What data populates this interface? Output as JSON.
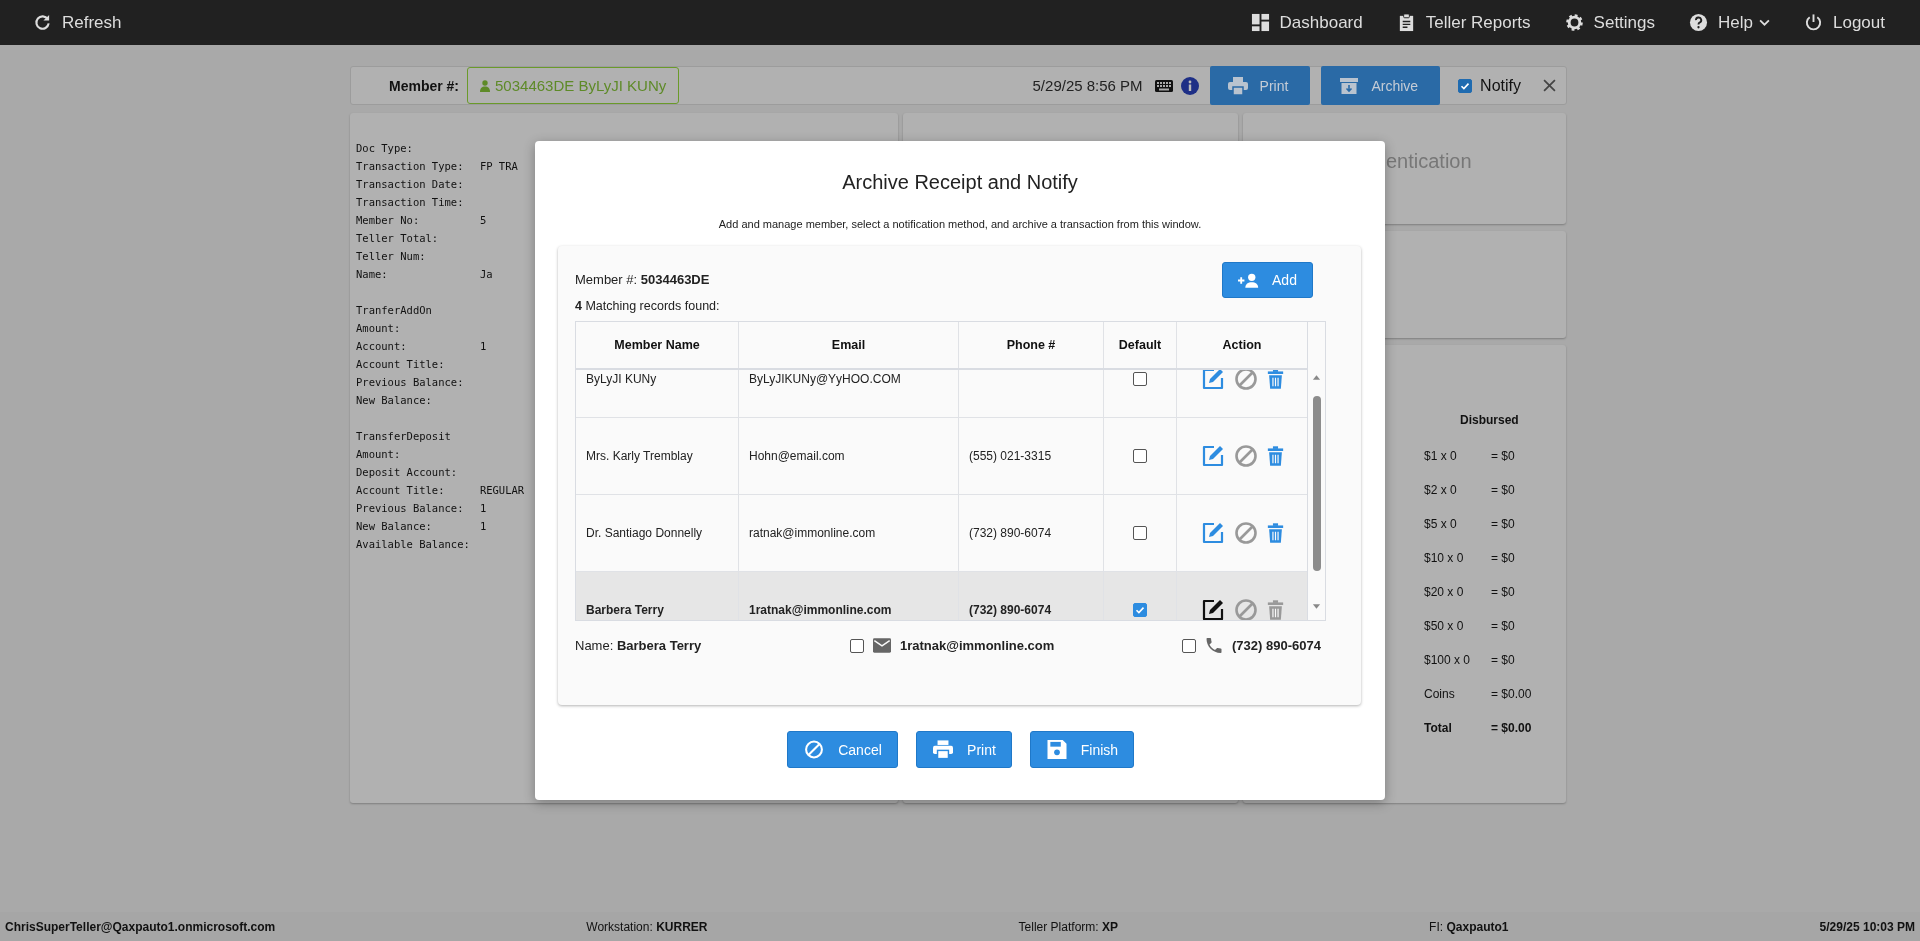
{
  "top_nav": {
    "left": {
      "label": "Refresh"
    },
    "right": [
      {
        "label": "Dashboard",
        "has_menu": false
      },
      {
        "label": "Teller Reports",
        "has_menu": false
      },
      {
        "label": "Settings",
        "has_menu": false
      },
      {
        "label": "Help",
        "has_menu": true
      },
      {
        "label": "Logout",
        "has_menu": false
      }
    ]
  },
  "header": {
    "member_label": "Member #:",
    "member_badge": "5034463DE ByLyJI KUNy",
    "datetime": "5/29/25 8:56 PM",
    "print_button": "Print",
    "archive_button": "Archive",
    "notify": {
      "label": "Notify",
      "checked": true
    }
  },
  "receipt": {
    "sections": [
      [
        {
          "label": "Doc Type:"
        },
        {
          "label": "Transaction Type:",
          "value": "FP TRA"
        },
        {
          "label": "Transaction Date:"
        },
        {
          "label": "Transaction Time:"
        },
        {
          "label": "Member No:",
          "value": "5"
        },
        {
          "label": "Teller Total:"
        },
        {
          "label": "Teller Num:"
        },
        {
          "label": "Name:",
          "value": "Ja"
        }
      ],
      [
        {
          "label": "TranferAddOn"
        },
        {
          "label": "Amount:"
        },
        {
          "label": "Account:",
          "value": "1"
        },
        {
          "label": "Account Title:"
        },
        {
          "label": "Previous Balance:"
        },
        {
          "label": "New Balance:"
        }
      ],
      [
        {
          "label": "TransferDeposit"
        },
        {
          "label": "Amount:"
        },
        {
          "label": "Deposit Account:"
        },
        {
          "label": "Account Title:",
          "value": "REGULAR"
        },
        {
          "label": "Previous Balance:",
          "value": "1"
        },
        {
          "label": "New Balance:",
          "value": "1"
        },
        {
          "label": "Available Balance:"
        }
      ]
    ]
  },
  "auth_panel": {
    "title": "entication"
  },
  "disbursed": {
    "title": "Disbursed",
    "rows": [
      {
        "kind": "row",
        "label": "$1 x 0",
        "value": "= $0"
      },
      {
        "kind": "row",
        "label": "$2 x 0",
        "value": "= $0"
      },
      {
        "kind": "row",
        "label": "$5 x 0",
        "value": "= $0"
      },
      {
        "kind": "row",
        "label": "$10 x 0",
        "value": "= $0"
      },
      {
        "kind": "row",
        "label": "$20 x 0",
        "value": "= $0"
      },
      {
        "kind": "row",
        "label": "$50 x 0",
        "value": "= $0"
      },
      {
        "kind": "row",
        "label": "$100 x 0",
        "value": "= $0"
      },
      {
        "kind": "row",
        "label": "Coins",
        "value": "= $0.00"
      },
      {
        "kind": "total",
        "label": "Total",
        "value": "= $0.00"
      }
    ]
  },
  "modal": {
    "title": "Archive Receipt and Notify",
    "subtitle": "Add and manage member, select a notification method, and archive a transaction from this window.",
    "member_label": "Member #:",
    "member_value": "5034463DE",
    "add_button": "Add",
    "match_count": "4",
    "match_text": "Matching records found:",
    "table": {
      "columns": [
        "Member Name",
        "Email",
        "Phone #",
        "Default",
        "Action"
      ],
      "rows": [
        {
          "name": "ByLyJI KUNy",
          "email": "ByLyJIKUNy@YyHOO.COM",
          "default": false,
          "selected": false
        },
        {
          "name": "Mrs. Karly Tremblay",
          "email": "Hohn@email.com",
          "phone": "(555) 021-3315",
          "default": false,
          "selected": false
        },
        {
          "name": "Dr. Santiago Donnelly",
          "email": "ratnak@immonline.com",
          "phone": "(732) 890-6074",
          "default": false,
          "selected": false
        },
        {
          "name": "Barbera Terry",
          "email": "1ratnak@immonline.com",
          "phone": "(732) 890-6074",
          "default": true,
          "selected": true
        }
      ]
    },
    "selection": {
      "name_label": "Name:",
      "name": "Barbera Terry",
      "email": {
        "value": "1ratnak@immonline.com",
        "checked": false
      },
      "phone": {
        "value": "(732) 890-6074",
        "checked": false
      }
    },
    "buttons": [
      "Cancel",
      "Print",
      "Finish"
    ]
  },
  "status_bar": [
    {
      "value": "ChrisSuperTeller@Qaxpauto1.onmicrosoft.com"
    },
    {
      "label": "Workstation:",
      "value": "KURRER"
    },
    {
      "label": "Teller Platform:",
      "value": "XP"
    },
    {
      "label": "FI:",
      "value": "Qaxpauto1"
    },
    {
      "value": "5/29/25 10:03 PM"
    }
  ]
}
